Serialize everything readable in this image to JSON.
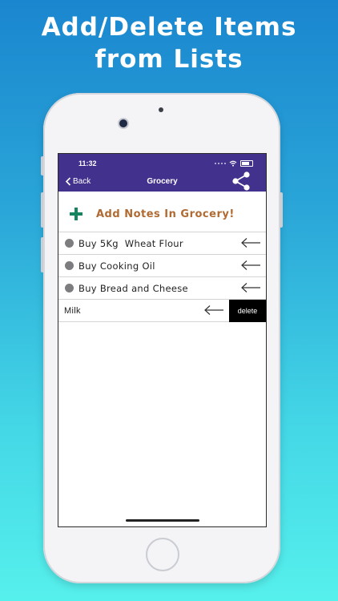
{
  "promo": {
    "line1": "Add/Delete Items",
    "line2": "from Lists"
  },
  "status_bar": {
    "time": "11:32"
  },
  "nav": {
    "back_label": "Back",
    "title": "Grocery",
    "share_icon": "share-icon"
  },
  "add_note": {
    "label": "Add Notes In Grocery!",
    "icon": "plus-icon",
    "color": "#b06a32",
    "icon_color": "#16845e"
  },
  "items": [
    {
      "text": "Buy 5Kg  Wheat Flour"
    },
    {
      "text": "Buy Cooking Oil"
    },
    {
      "text": "Buy Bread and Cheese"
    }
  ],
  "swiped_item": {
    "text": "Milk",
    "delete_label": "delete"
  },
  "colors": {
    "nav_bar": "#43318e",
    "background_top": "#1a86cf",
    "background_bottom": "#56f0ec"
  }
}
